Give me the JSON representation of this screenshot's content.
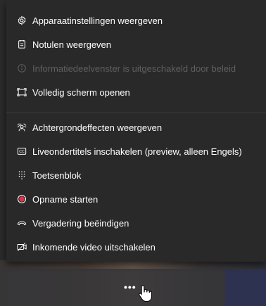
{
  "menu": {
    "items": [
      {
        "label": "Apparaatinstellingen weergeven",
        "icon": "gear-icon",
        "enabled": true
      },
      {
        "label": "Notulen weergeven",
        "icon": "notes-icon",
        "enabled": true
      },
      {
        "label": "Informatiedeelvenster is uitgeschakeld door beleid",
        "icon": "info-icon",
        "enabled": false
      },
      {
        "label": "Volledig scherm openen",
        "icon": "fullscreen-icon",
        "enabled": true
      },
      {
        "label": "Achtergrondeffecten weergeven",
        "icon": "background-effects-icon",
        "enabled": true
      },
      {
        "label": "Liveondertitels inschakelen (preview, alleen Engels)",
        "icon": "captions-icon",
        "enabled": true
      },
      {
        "label": "Toetsenblok",
        "icon": "dialpad-icon",
        "enabled": true
      },
      {
        "label": "Opname starten",
        "icon": "record-icon",
        "enabled": true
      },
      {
        "label": "Vergadering beëindigen",
        "icon": "hang-up-icon",
        "enabled": true
      },
      {
        "label": "Inkomende video uitschakelen",
        "icon": "video-off-icon",
        "enabled": true
      }
    ]
  },
  "toolbar": {
    "more_label": "•••"
  },
  "colors": {
    "menu_bg": "#292929",
    "text": "#ffffff",
    "disabled_text": "#5f5f5f",
    "record": "#e0304a"
  }
}
